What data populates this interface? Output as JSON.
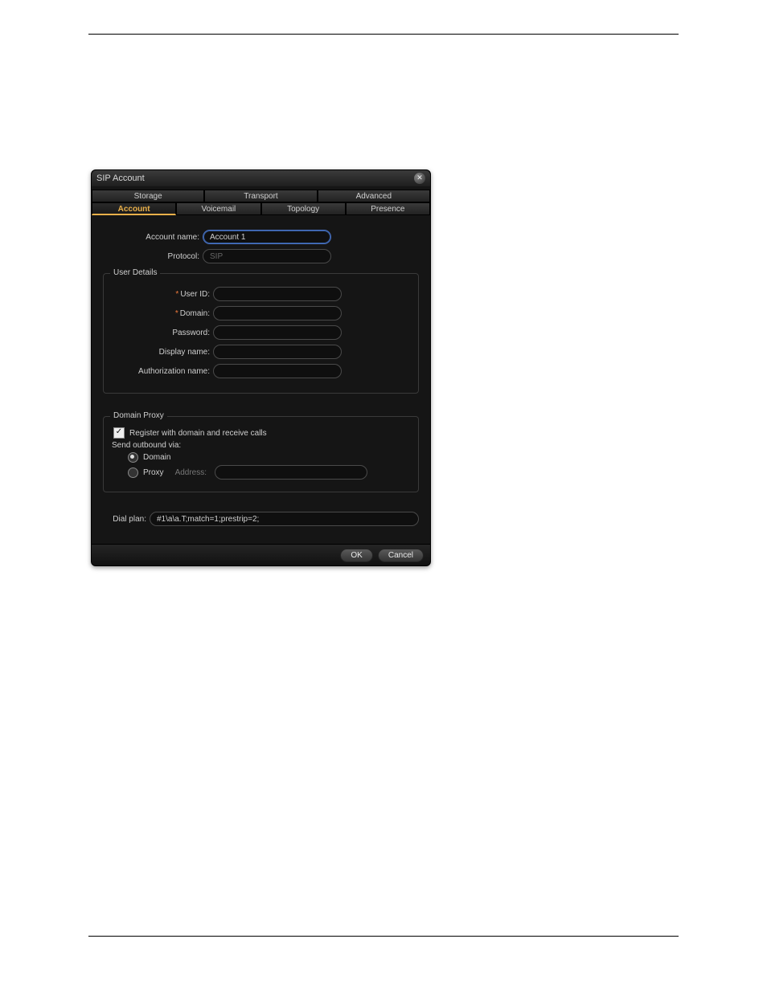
{
  "window": {
    "title": "SIP Account"
  },
  "tabs": {
    "top": [
      "Storage",
      "Transport",
      "Advanced"
    ],
    "bottom": [
      "Account",
      "Voicemail",
      "Topology",
      "Presence"
    ],
    "active_bottom_index": 0
  },
  "form": {
    "account_name": {
      "label": "Account name:",
      "value": "Account 1"
    },
    "protocol": {
      "label": "Protocol:",
      "value": "SIP"
    }
  },
  "user_details": {
    "legend": "User Details",
    "user_id": {
      "label": "User ID:",
      "required": true,
      "value": ""
    },
    "domain": {
      "label": "Domain:",
      "required": true,
      "value": ""
    },
    "password": {
      "label": "Password:",
      "value": ""
    },
    "display_name": {
      "label": "Display name:",
      "value": ""
    },
    "authorization_name": {
      "label": "Authorization name:",
      "value": ""
    }
  },
  "domain_proxy": {
    "legend": "Domain Proxy",
    "register_label": "Register with domain and receive calls",
    "register_checked": true,
    "send_outbound_label": "Send outbound via:",
    "domain_option": "Domain",
    "proxy_option": "Proxy",
    "proxy_address_label": "Address:",
    "proxy_address_value": "",
    "selected": "domain"
  },
  "dial_plan": {
    "label": "Dial plan:",
    "value": "#1\\a\\a.T;match=1;prestrip=2;"
  },
  "footer": {
    "ok": "OK",
    "cancel": "Cancel"
  }
}
